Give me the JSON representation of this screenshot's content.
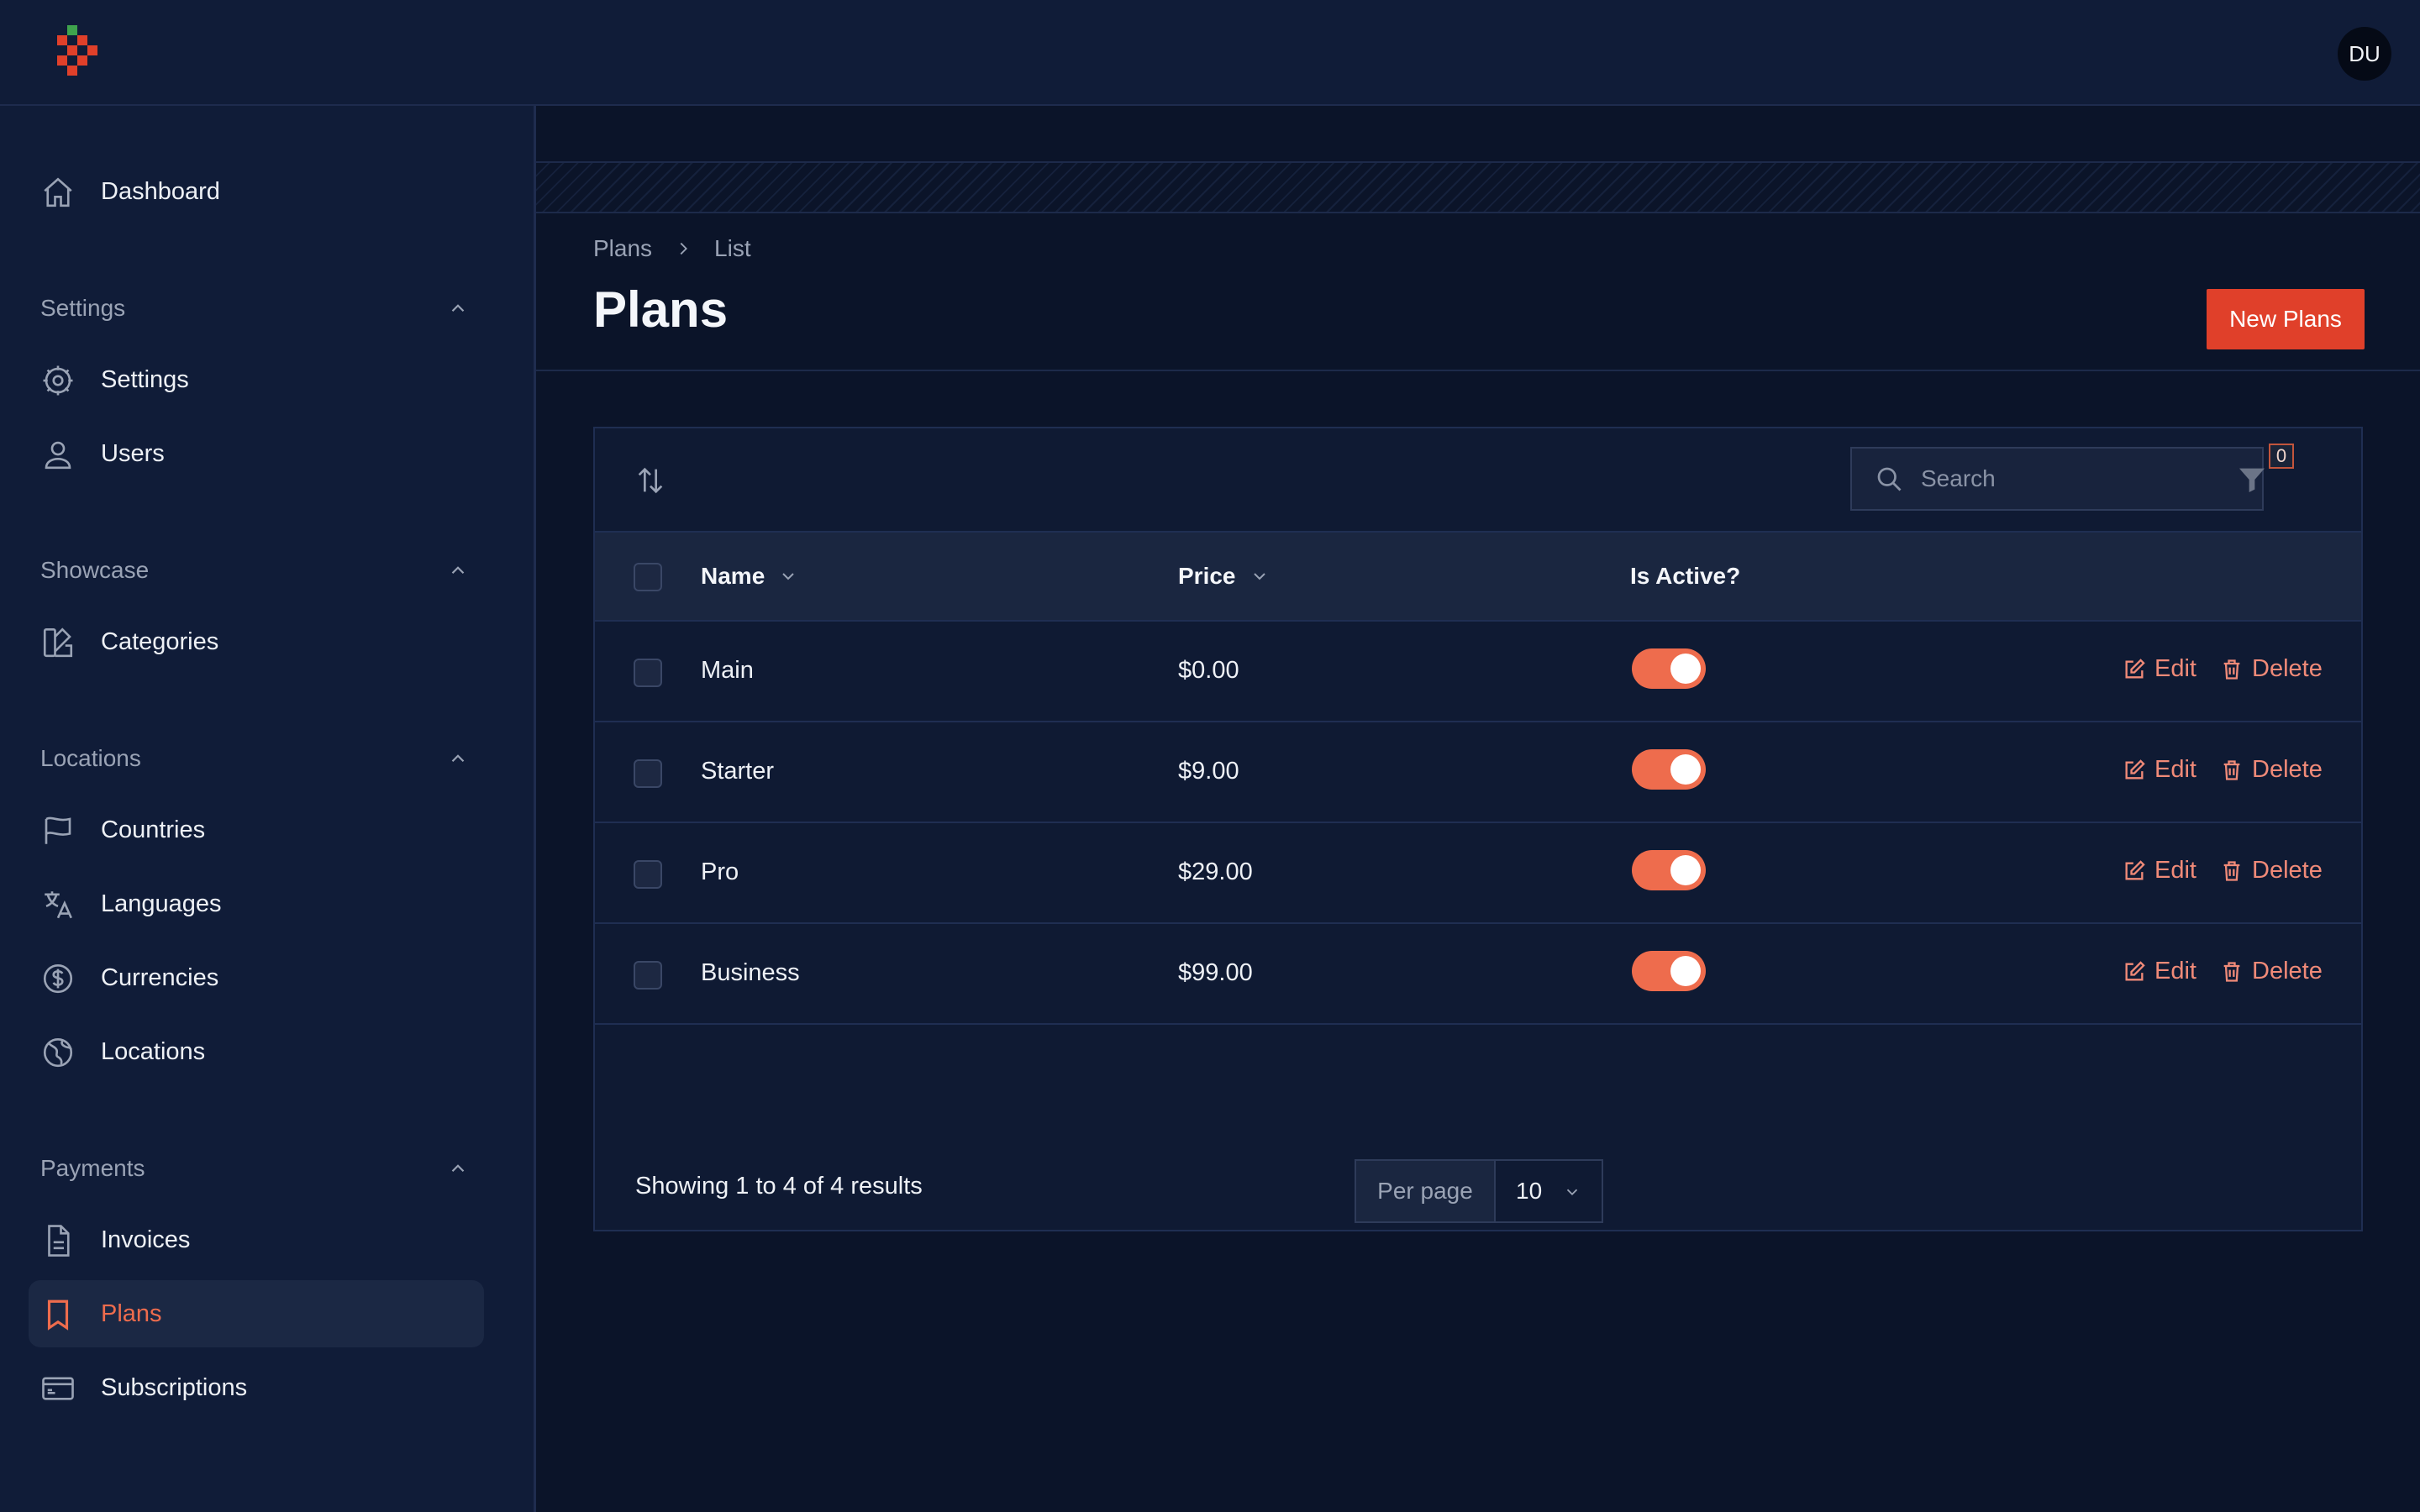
{
  "user": {
    "initials": "DU"
  },
  "sidebar": {
    "top_items": [
      {
        "label": "Dashboard",
        "icon": "home-icon"
      }
    ],
    "groups": [
      {
        "label": "Settings",
        "items": [
          {
            "label": "Settings",
            "icon": "gear-icon"
          },
          {
            "label": "Users",
            "icon": "user-icon"
          }
        ]
      },
      {
        "label": "Showcase",
        "items": [
          {
            "label": "Categories",
            "icon": "swatch-icon"
          }
        ]
      },
      {
        "label": "Locations",
        "items": [
          {
            "label": "Countries",
            "icon": "flag-icon"
          },
          {
            "label": "Languages",
            "icon": "translate-icon"
          },
          {
            "label": "Currencies",
            "icon": "dollar-icon"
          },
          {
            "label": "Locations",
            "icon": "globe-icon"
          }
        ]
      },
      {
        "label": "Payments",
        "items": [
          {
            "label": "Invoices",
            "icon": "document-icon"
          },
          {
            "label": "Plans",
            "icon": "bookmark-icon",
            "active": true
          },
          {
            "label": "Subscriptions",
            "icon": "credit-card-icon"
          }
        ]
      }
    ]
  },
  "header": {
    "breadcrumb": [
      "Plans",
      "List"
    ],
    "title": "Plans",
    "new_button": "New Plans"
  },
  "table": {
    "search_placeholder": "Search",
    "filter_count": "0",
    "columns": [
      "Name",
      "Price",
      "Is Active?"
    ],
    "rows": [
      {
        "name": "Main",
        "price": "$0.00",
        "active": true
      },
      {
        "name": "Starter",
        "price": "$9.00",
        "active": true
      },
      {
        "name": "Pro",
        "price": "$29.00",
        "active": true
      },
      {
        "name": "Business",
        "price": "$99.00",
        "active": true
      }
    ],
    "actions": {
      "edit": "Edit",
      "delete": "Delete"
    },
    "footer": {
      "showing": "Showing 1 to 4 of 4 results",
      "per_page_label": "Per page",
      "per_page_value": "10"
    }
  },
  "colors": {
    "accent": "#ee6c4d",
    "primary_button": "#e0402a",
    "background": "#0b1429",
    "sidebar": "#101c38"
  }
}
